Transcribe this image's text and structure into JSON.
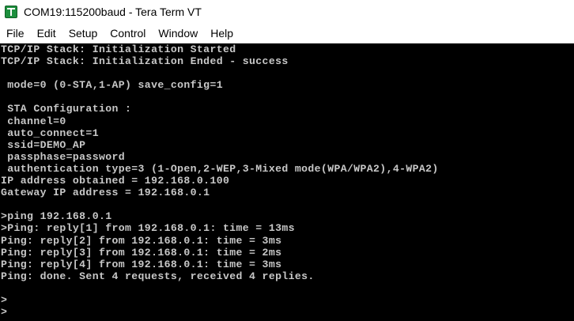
{
  "window": {
    "title": "COM19:115200baud - Tera Term VT",
    "icon": "tera-term-icon"
  },
  "menu": [
    "File",
    "Edit",
    "Setup",
    "Control",
    "Window",
    "Help"
  ],
  "terminal": {
    "background": "#000000",
    "foreground": "#c8c8c8",
    "lines": [
      "TCP/IP Stack: Initialization Started",
      "TCP/IP Stack: Initialization Ended - success",
      "",
      " mode=0 (0-STA,1-AP) save_config=1",
      "",
      " STA Configuration :",
      " channel=0",
      " auto_connect=1",
      " ssid=DEMO_AP",
      " passphase=password",
      " authentication type=3 (1-Open,2-WEP,3-Mixed mode(WPA/WPA2),4-WPA2)",
      "IP address obtained = 192.168.0.100",
      "Gateway IP address = 192.168.0.1",
      "",
      ">ping 192.168.0.1",
      ">Ping: reply[1] from 192.168.0.1: time = 13ms",
      "Ping: reply[2] from 192.168.0.1: time = 3ms",
      "Ping: reply[3] from 192.168.0.1: time = 2ms",
      "Ping: reply[4] from 192.168.0.1: time = 3ms",
      "Ping: done. Sent 4 requests, received 4 replies.",
      "",
      ">",
      ">"
    ]
  }
}
